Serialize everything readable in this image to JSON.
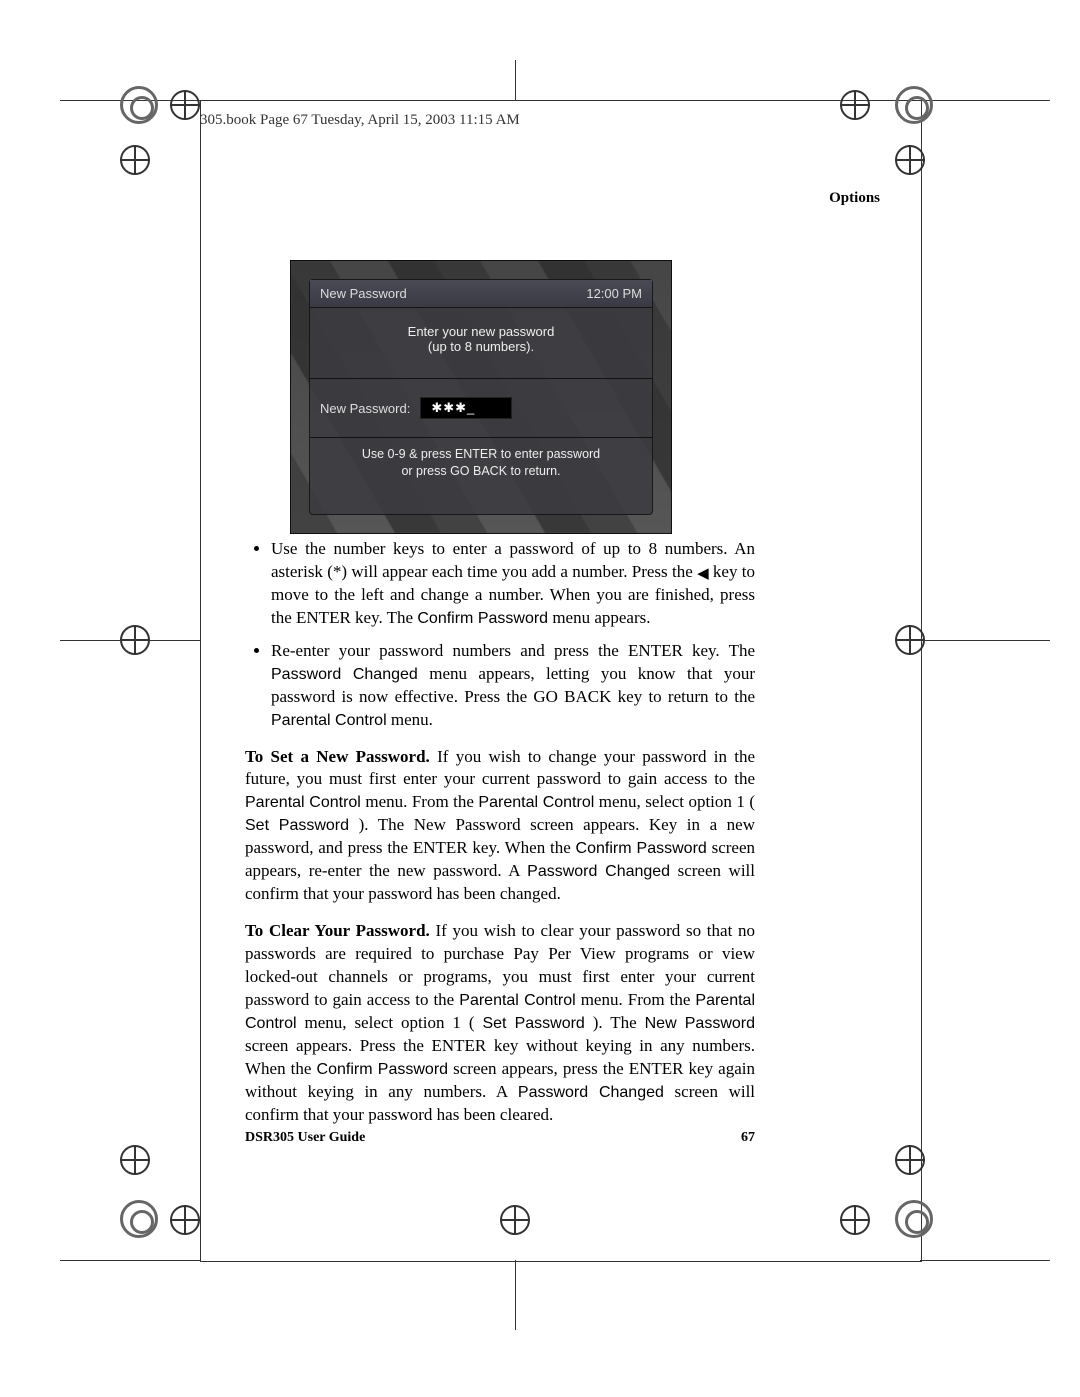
{
  "header": {
    "imprint": "305.book  Page 67  Tuesday, April 15, 2003  11:15 AM",
    "running_head": "Options"
  },
  "screenshot": {
    "title": "New Password",
    "time": "12:00 PM",
    "prompt_lines": [
      "Enter your new password",
      "(up to 8 numbers)."
    ],
    "field_label": "New Password:",
    "field_value": "✱✱✱_",
    "hint_lines": [
      "Use 0-9 & press ENTER to enter password",
      "or press GO BACK to return."
    ]
  },
  "bullets": [
    {
      "pre": "Use the number keys to enter a password of up to 8 numbers. An asterisk (*) will appear each time you add a number. Press the ",
      "arrow": "◀",
      "mid": " key to move to the left and change a number. When you are finished, press the ENTER key. The ",
      "menu1": "Confirm Password",
      "post": " menu appears."
    },
    {
      "pre": "Re-enter your password numbers and press the ENTER key. The ",
      "menu1": "Password Changed",
      "mid": " menu appears, letting you know that your password is now effective. Press the GO BACK key to return to the ",
      "menu2": "Parental Control",
      "post": " menu."
    }
  ],
  "para_set": {
    "lead": "To Set a New Password.",
    "p1": " If you wish to change your password in the future, you must first enter your current password to gain access to the ",
    "m1": "Parental Control",
    "p2": " menu. From the ",
    "m2": "Parental Control",
    "p3": " menu, select option 1 (",
    "m3": "Set Password",
    "p4": "). The New Password screen appears. Key in a new password, and press the ENTER key. When the ",
    "m4": "Confirm Password",
    "p5": " screen appears, re-enter the new password. A ",
    "m5": "Password Changed",
    "p6": " screen will confirm that your password has been changed."
  },
  "para_clear": {
    "lead": "To Clear Your Password.",
    "p1": " If you wish to clear your password so that no passwords are required to purchase Pay Per View programs or view locked-out channels or programs, you must first enter your current password to gain access to the ",
    "m1": "Parental Control",
    "p2": " menu. From the ",
    "m2": "Parental Control",
    "p3": " menu, select option 1 (",
    "m3": "Set Password",
    "p4": "). The ",
    "m4": "New Password",
    "p5": " screen appears. Press the ENTER key without keying in any numbers. When the ",
    "m5": "Confirm Password",
    "p6": " screen appears, press the ENTER key again without keying in any numbers. A ",
    "m6": "Password Changed",
    "p7": " screen will confirm that your password has been cleared."
  },
  "footer": {
    "guide": "DSR305 User Guide",
    "page": "67"
  }
}
